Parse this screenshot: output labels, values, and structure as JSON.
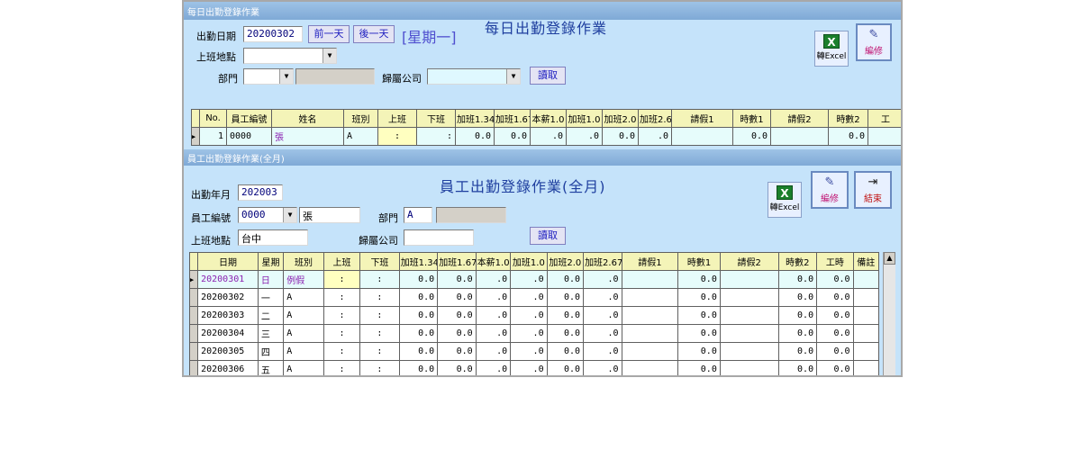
{
  "top": {
    "window_title": "每日出勤登錄作業",
    "heading": "每日出勤登錄作業",
    "date_label": "出勤日期",
    "date_value": "20200302",
    "prev_btn": "前一天",
    "next_btn": "後一天",
    "weekday": "[星期一]",
    "location_label": "上班地點",
    "location_value": "",
    "dept_label": "部門",
    "dept_value": "",
    "dept_name": "",
    "company_label": "歸屬公司",
    "company_value": "",
    "read_btn": "讀取",
    "excel_btn": "轉Excel",
    "edit_btn": "編修",
    "columns": [
      "No.",
      "員工編號",
      "姓名",
      "班別",
      "上班",
      "下班",
      "加班1.34",
      "加班1.67",
      "本薪1.0",
      "加班1.0",
      "加班2.0",
      "加班2.67",
      "請假1",
      "時數1",
      "請假2",
      "時數2",
      "工"
    ],
    "rows": [
      [
        "1",
        "0000",
        "張",
        "A",
        ":",
        ":",
        "0.0",
        "0.0",
        ".0",
        ".0",
        "0.0",
        ".0",
        "",
        "0.0",
        "",
        "0.0",
        ""
      ]
    ]
  },
  "bottom": {
    "window_title": "員工出勤登錄作業(全月)",
    "heading": "員工出勤登錄作業(全月)",
    "month_label": "出勤年月",
    "month_value": "202003",
    "emp_label": "員工編號",
    "emp_value": "0000",
    "emp_name": "張",
    "dept_label": "部門",
    "dept_value": "A",
    "dept_name": "",
    "location_label": "上班地點",
    "location_value": "台中",
    "company_label": "歸屬公司",
    "company_value": "",
    "read_btn": "讀取",
    "excel_btn": "轉Excel",
    "edit_btn": "編修",
    "exit_btn": "結束",
    "columns": [
      "日期",
      "星期",
      "班別",
      "上班",
      "下班",
      "加班1.34",
      "加班1.67",
      "本薪1.0",
      "加班1.0",
      "加班2.0",
      "加班2.67",
      "請假1",
      "時數1",
      "請假2",
      "時數2",
      "工時",
      "備註"
    ],
    "rows": [
      [
        "20200301",
        "日",
        "例假",
        ":",
        ":",
        "0.0",
        "0.0",
        ".0",
        ".0",
        "0.0",
        ".0",
        "",
        "0.0",
        "",
        "0.0",
        "0.0",
        ""
      ],
      [
        "20200302",
        "一",
        "A",
        ":",
        ":",
        "0.0",
        "0.0",
        ".0",
        ".0",
        "0.0",
        ".0",
        "",
        "0.0",
        "",
        "0.0",
        "0.0",
        ""
      ],
      [
        "20200303",
        "二",
        "A",
        ":",
        ":",
        "0.0",
        "0.0",
        ".0",
        ".0",
        "0.0",
        ".0",
        "",
        "0.0",
        "",
        "0.0",
        "0.0",
        ""
      ],
      [
        "20200304",
        "三",
        "A",
        ":",
        ":",
        "0.0",
        "0.0",
        ".0",
        ".0",
        "0.0",
        ".0",
        "",
        "0.0",
        "",
        "0.0",
        "0.0",
        ""
      ],
      [
        "20200305",
        "四",
        "A",
        ":",
        ":",
        "0.0",
        "0.0",
        ".0",
        ".0",
        "0.0",
        ".0",
        "",
        "0.0",
        "",
        "0.0",
        "0.0",
        ""
      ],
      [
        "20200306",
        "五",
        "A",
        ":",
        ":",
        "0.0",
        "0.0",
        ".0",
        ".0",
        "0.0",
        ".0",
        "",
        "0.0",
        "",
        "0.0",
        "0.0",
        ""
      ]
    ]
  }
}
